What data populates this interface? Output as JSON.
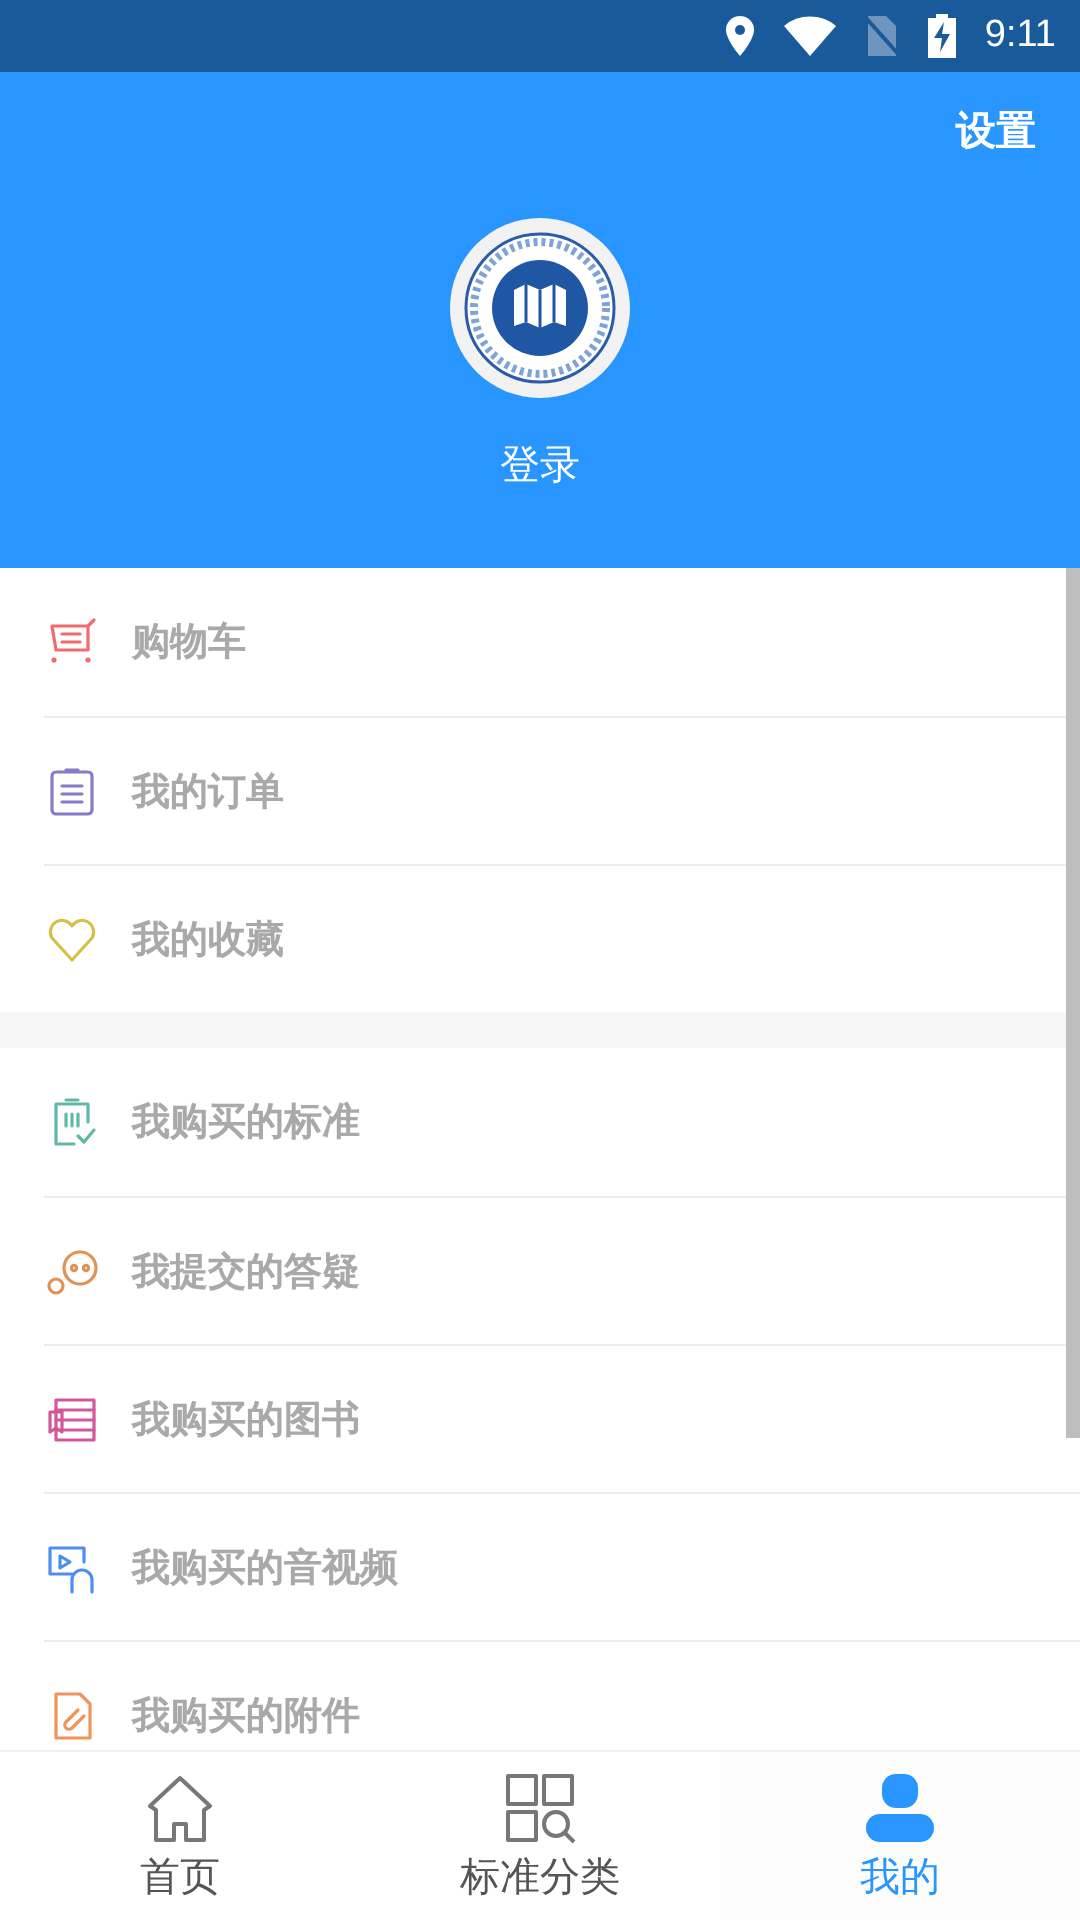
{
  "status_bar": {
    "time": "9:11"
  },
  "header": {
    "settings": "设置",
    "login": "登录"
  },
  "menu_sections": [
    {
      "items": [
        {
          "kind": "cart",
          "label": "购物车",
          "color": "#f26b6b"
        },
        {
          "kind": "order",
          "label": "我的订单",
          "color": "#8a78c8"
        },
        {
          "kind": "heart",
          "label": "我的收藏",
          "color": "#d7c04a"
        }
      ]
    },
    {
      "items": [
        {
          "kind": "standard",
          "label": "我购买的标准",
          "color": "#5fb9a4"
        },
        {
          "kind": "chat",
          "label": "我提交的答疑",
          "color": "#e39256"
        },
        {
          "kind": "book",
          "label": "我购买的图书",
          "color": "#d2589a"
        },
        {
          "kind": "video",
          "label": "我购买的音视频",
          "color": "#4d8ff0"
        },
        {
          "kind": "attachment",
          "label": "我购买的附件",
          "color": "#f2935a"
        }
      ]
    }
  ],
  "tabs": [
    {
      "kind": "home",
      "label": "首页",
      "selected": false
    },
    {
      "kind": "category",
      "label": "标准分类",
      "selected": false
    },
    {
      "kind": "user",
      "label": "我的",
      "selected": true
    }
  ]
}
